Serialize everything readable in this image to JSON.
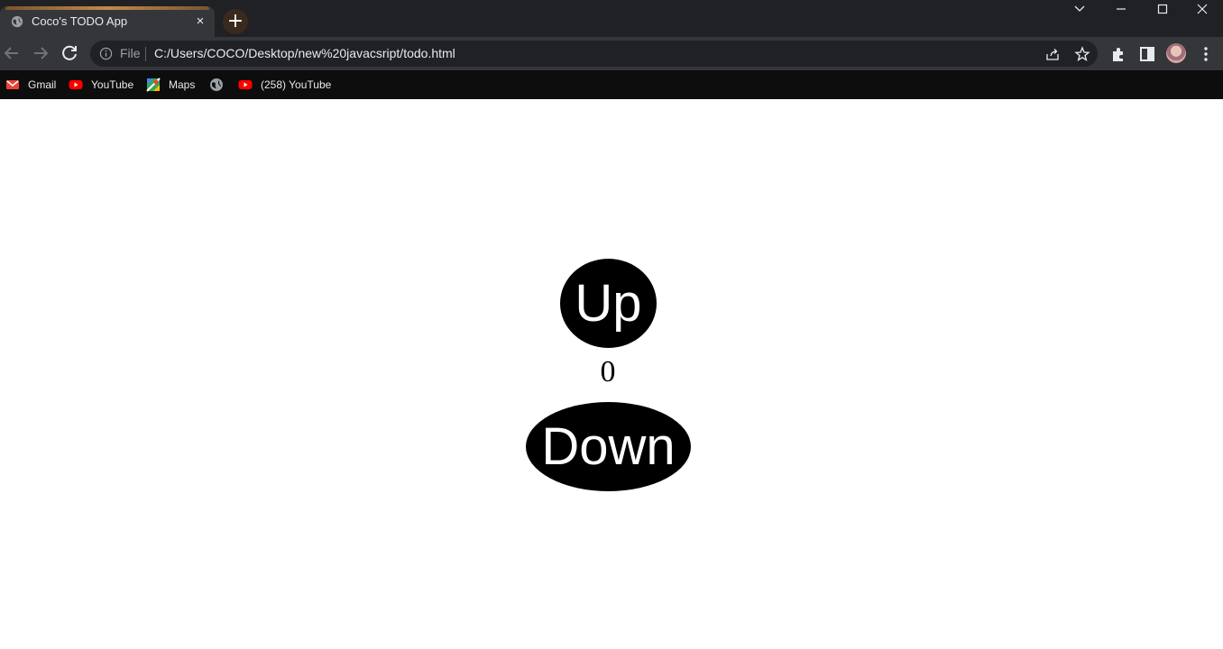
{
  "browser": {
    "tab": {
      "title": "Coco's TODO App",
      "favicon": "globe-icon",
      "close": "×"
    },
    "new_tab": "+",
    "window_controls": [
      "tab-search-icon",
      "minimize-icon",
      "maximize-icon",
      "close-icon"
    ],
    "address_bar": {
      "scheme_label": "File",
      "url": "C:/Users/COCO/Desktop/new%20javacsript/todo.html"
    },
    "bookmarks": [
      {
        "label": "Gmail",
        "icon": "gmail-icon"
      },
      {
        "label": "YouTube",
        "icon": "youtube-icon"
      },
      {
        "label": "Maps",
        "icon": "maps-icon"
      },
      {
        "label": "",
        "icon": "globe-icon"
      },
      {
        "label": "(258) YouTube",
        "icon": "youtube-icon"
      }
    ],
    "colors": {
      "tabstrip": "#202124",
      "toolbar": "#35363a",
      "bookmarks_bar": "#0d0d0d",
      "accent": "#c08a4a"
    }
  },
  "app": {
    "up_label": "Up",
    "count": "0",
    "down_label": "Down",
    "colors": {
      "button_bg": "#000000",
      "button_text": "#ffffff",
      "page_bg": "#ffffff"
    }
  }
}
